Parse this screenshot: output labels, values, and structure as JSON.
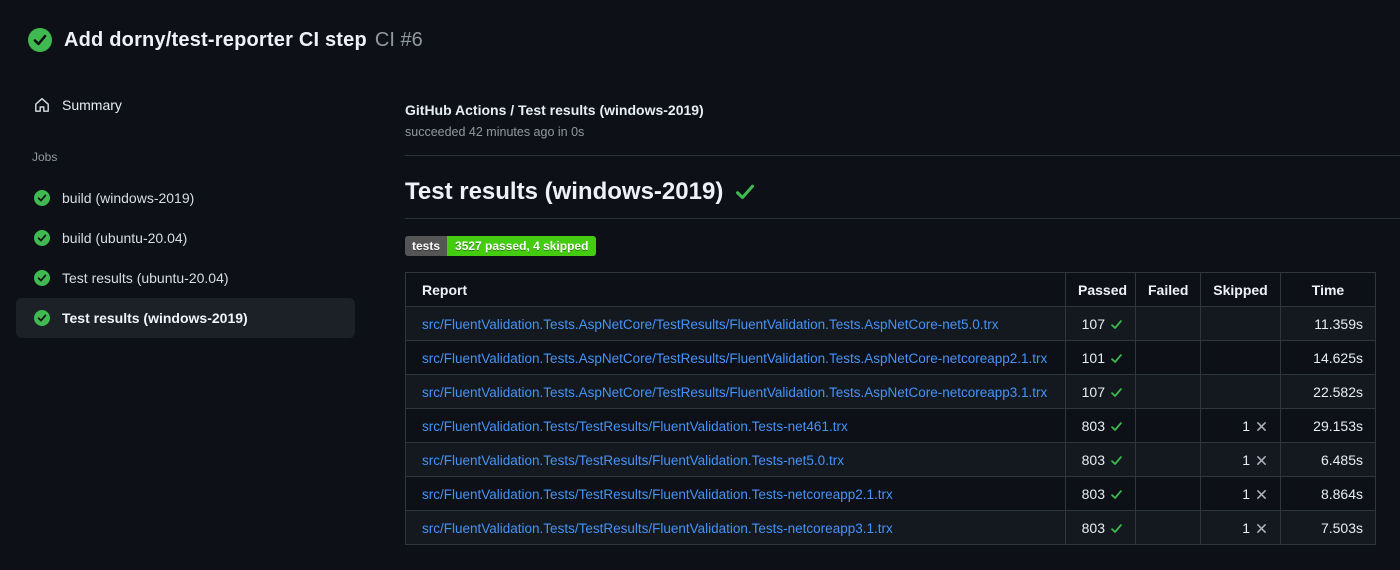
{
  "header": {
    "title": "Add dorny/test-reporter CI step",
    "run_number": "CI #6",
    "status": "success"
  },
  "sidebar": {
    "summary_label": "Summary",
    "jobs_label": "Jobs",
    "jobs": [
      {
        "label": "build (windows-2019)",
        "status": "success",
        "selected": false
      },
      {
        "label": "build (ubuntu-20.04)",
        "status": "success",
        "selected": false
      },
      {
        "label": "Test results (ubuntu-20.04)",
        "status": "success",
        "selected": false
      },
      {
        "label": "Test results (windows-2019)",
        "status": "success",
        "selected": true
      }
    ]
  },
  "main": {
    "job_title": "GitHub Actions / Test results (windows-2019)",
    "job_status_line": "succeeded 42 minutes ago in 0s",
    "section_title": "Test results (windows-2019)",
    "badge": {
      "label": "tests",
      "value": "3527 passed, 4 skipped",
      "label_bg": "#555555",
      "value_bg": "#44cc11"
    },
    "table": {
      "columns": [
        "Report",
        "Passed",
        "Failed",
        "Skipped",
        "Time"
      ],
      "rows": [
        {
          "report": "src/FluentValidation.Tests.AspNetCore/TestResults/FluentValidation.Tests.AspNetCore-net5.0.trx",
          "passed": "107",
          "failed": "",
          "skipped": "",
          "time": "11.359s"
        },
        {
          "report": "src/FluentValidation.Tests.AspNetCore/TestResults/FluentValidation.Tests.AspNetCore-netcoreapp2.1.trx",
          "passed": "101",
          "failed": "",
          "skipped": "",
          "time": "14.625s"
        },
        {
          "report": "src/FluentValidation.Tests.AspNetCore/TestResults/FluentValidation.Tests.AspNetCore-netcoreapp3.1.trx",
          "passed": "107",
          "failed": "",
          "skipped": "",
          "time": "22.582s"
        },
        {
          "report": "src/FluentValidation.Tests/TestResults/FluentValidation.Tests-net461.trx",
          "passed": "803",
          "failed": "",
          "skipped": "1",
          "time": "29.153s"
        },
        {
          "report": "src/FluentValidation.Tests/TestResults/FluentValidation.Tests-net5.0.trx",
          "passed": "803",
          "failed": "",
          "skipped": "1",
          "time": "6.485s"
        },
        {
          "report": "src/FluentValidation.Tests/TestResults/FluentValidation.Tests-netcoreapp2.1.trx",
          "passed": "803",
          "failed": "",
          "skipped": "1",
          "time": "8.864s"
        },
        {
          "report": "src/FluentValidation.Tests/TestResults/FluentValidation.Tests-netcoreapp3.1.trx",
          "passed": "803",
          "failed": "",
          "skipped": "1",
          "time": "7.503s"
        }
      ]
    }
  },
  "colors": {
    "background": "#0d1117",
    "success_green": "#3fb950",
    "link_blue": "#4493f8",
    "muted_text": "#9198a1",
    "table_border": "#30363d",
    "selected_job_bg": "#1c2128",
    "badge_label_bg": "#555555",
    "badge_value_bg": "#44cc11"
  }
}
